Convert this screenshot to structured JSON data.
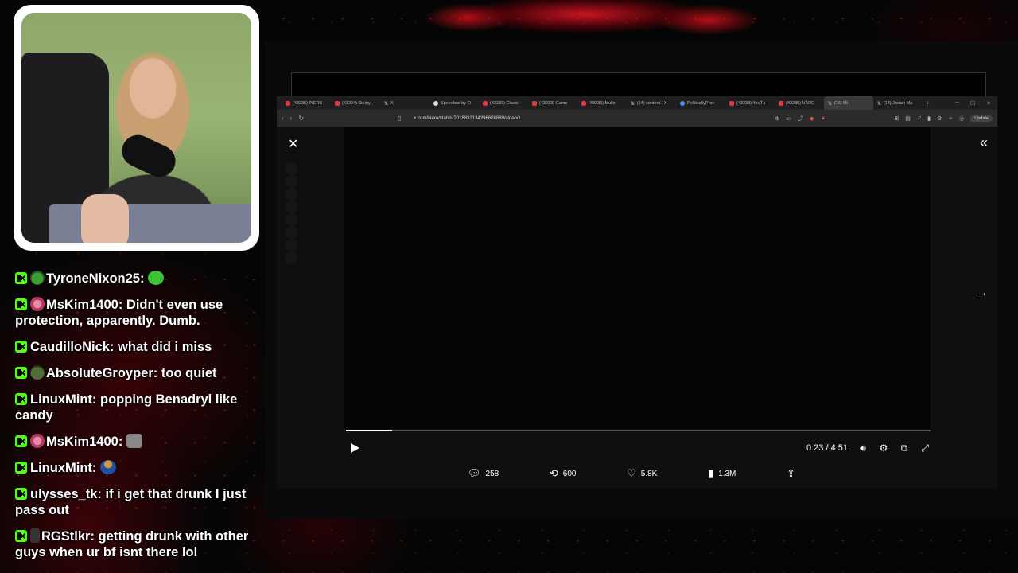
{
  "chat": {
    "messages": [
      {
        "user": "TyroneNixon25",
        "text": "",
        "badge": "frog",
        "emote": "green-blob"
      },
      {
        "user": "MsKim1400",
        "text": "Didn't even use protection, apparently. Dumb.",
        "badge": "pink-badge"
      },
      {
        "user": "CaudilloNick",
        "text": "what did i miss"
      },
      {
        "user": "AbsoluteGroyper",
        "text": "too quiet",
        "badge": "helmet"
      },
      {
        "user": "LinuxMint",
        "text": "popping Benadryl like candy"
      },
      {
        "user": "MsKim1400",
        "text": "",
        "badge": "pink-badge",
        "emote": "cat"
      },
      {
        "user": "LinuxMint",
        "text": "",
        "emote": "bowl"
      },
      {
        "user": "ulysses_tk",
        "text": "if i get that drunk I just pass out"
      },
      {
        "user": "RGStlkr",
        "text": "getting drunk with other guys when ur bf isnt there lol",
        "badge": "cross"
      }
    ]
  },
  "browser": {
    "tabs": [
      {
        "label": "(43235) PIERS",
        "icon": "youtube"
      },
      {
        "label": "(43234) Steiny",
        "icon": "youtube"
      },
      {
        "label": "X",
        "icon": "x"
      },
      {
        "label": "Speedtest by O",
        "icon": "globe"
      },
      {
        "label": "(43233) Clavic",
        "icon": "youtube"
      },
      {
        "label": "(43233) Game",
        "icon": "youtube"
      },
      {
        "label": "(43235) Mulle",
        "icon": "youtube"
      },
      {
        "label": "(14) content / X",
        "icon": "x"
      },
      {
        "label": "PoliticallyProv",
        "icon": "globe"
      },
      {
        "label": "(43233) YouTu",
        "icon": "youtube"
      },
      {
        "label": "(43235) HARD",
        "icon": "youtube"
      },
      {
        "label": "(16) Mi",
        "icon": "x",
        "active": true
      },
      {
        "label": "(14) Josiah Ma",
        "icon": "x"
      }
    ],
    "url": "x.com/Nero/status/2018832134396608889/video/1",
    "update_label": "Update"
  },
  "video": {
    "current_time": "0:23",
    "duration": "4:51",
    "progress": 0.079
  },
  "actions": {
    "replies": "258",
    "reposts": "600",
    "likes": "5.8K",
    "views": "1.3M"
  },
  "colors": {
    "kick_green": "#53fc18",
    "background": "#060505",
    "accent_red": "#d21423"
  }
}
